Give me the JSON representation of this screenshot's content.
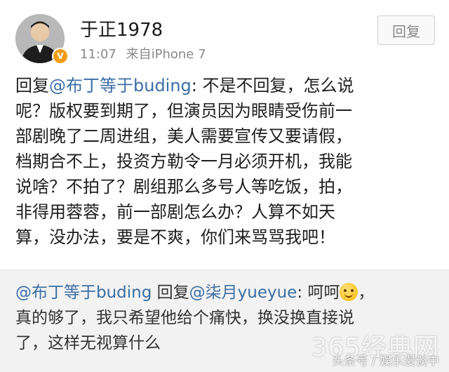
{
  "post": {
    "username": "于正1978",
    "time": "11:07",
    "source": "来自iPhone 7",
    "reply_button": "回复",
    "avatar_icon": "user-avatar-icon",
    "verified_icon": "verified-badge-icon",
    "verified_color": "#f39c12",
    "text": {
      "l1_prefix": "回复",
      "l1_mention": "@布丁等于buding",
      "l1_rest": ": 不是不回复，怎么说",
      "l2": "呢？版权要到期了，但演员因为眼睛受伤前一",
      "l3": "部剧晚了二周进组，美人需要宣传又要请假，",
      "l4": "档期合不上，投资方勒令一月必须开机，我能",
      "l5": "说啥？不拍了？剧组那么多号人等吃饭，拍，",
      "l6": "非得用蓉蓉，前一部剧怎么办？人算不如天",
      "l7": "算，没办法，要是不爽，你们来骂骂我吧！"
    }
  },
  "quoted": {
    "author_mention": "@布丁等于buding",
    "reply_word": " 回复",
    "target_mention": "@柒月yueyue",
    "l1_rest": ": 呵呵",
    "emoji_icon": "smile-emoji-icon",
    "l1_end": "，",
    "l2": "真的够了，我只希望他给个痛快，换没换直接说",
    "l3": "了，这样无视算什么"
  },
  "watermark": {
    "site": "365经典网",
    "source": "头条号 / 娱乐漫谈中"
  },
  "colors": {
    "mention": "#3a6ea5",
    "quoted_bg": "#f2f2f2"
  }
}
